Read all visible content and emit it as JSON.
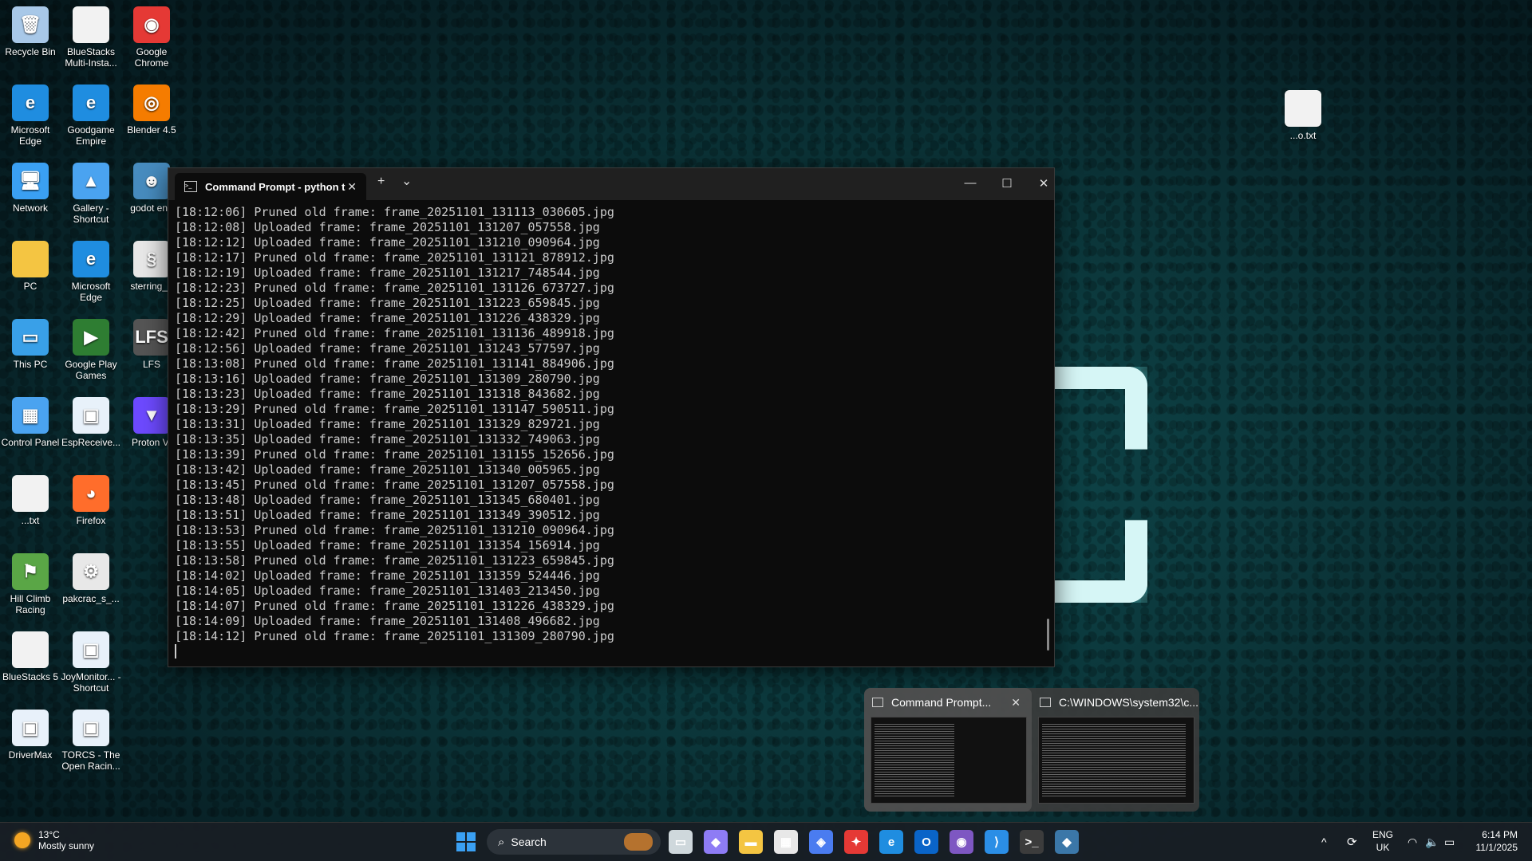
{
  "desktop": {
    "icons": [
      {
        "label": "Recycle Bin",
        "glyph": "🗑",
        "color": "#a8c8e8"
      },
      {
        "label": "BlueStacks Multi-Insta...",
        "glyph": "",
        "color": "#f2f2f2"
      },
      {
        "label": "Google Chrome",
        "glyph": "◉",
        "color": "#e53935"
      },
      {
        "label": "Microsoft Edge",
        "glyph": "e",
        "color": "#1f8de0"
      },
      {
        "label": "Goodgame Empire",
        "glyph": "e",
        "color": "#1f8de0"
      },
      {
        "label": "Blender 4.5",
        "glyph": "◎",
        "color": "#f57c00"
      },
      {
        "label": "Network",
        "glyph": "🖥",
        "color": "#3aa0f3"
      },
      {
        "label": "Gallery - Shortcut",
        "glyph": "▲",
        "color": "#4aa3f0"
      },
      {
        "label": "godot eng",
        "glyph": "☻",
        "color": "#478cbf"
      },
      {
        "label": "PC",
        "glyph": "",
        "color": "#f4c542"
      },
      {
        "label": "Microsoft Edge",
        "glyph": "e",
        "color": "#1f8de0"
      },
      {
        "label": "sterring_a",
        "glyph": "§",
        "color": "#e8e8e8"
      },
      {
        "label": "This PC",
        "glyph": "▭",
        "color": "#39a0e8"
      },
      {
        "label": "Google Play Games",
        "glyph": "▶",
        "color": "#2e7d32"
      },
      {
        "label": "LFS",
        "glyph": "LFS",
        "color": "#555"
      },
      {
        "label": "Control Panel",
        "glyph": "▦",
        "color": "#4aa3f0"
      },
      {
        "label": "EspReceive...",
        "glyph": "▣",
        "color": "#e8f1fa"
      },
      {
        "label": "Proton VI",
        "glyph": "▼",
        "color": "#6d4aff"
      },
      {
        "label": "...txt",
        "glyph": "",
        "color": "#f2f2f2"
      },
      {
        "label": "Firefox",
        "glyph": "◕",
        "color": "#ff6d2b"
      },
      {
        "label": "Hill Climb Racing",
        "glyph": "⚑",
        "color": "#5aa646"
      },
      {
        "label": "pakcrac_s_...",
        "glyph": "⚙",
        "color": "#e8e8e8"
      },
      {
        "label": "BlueStacks 5",
        "glyph": "",
        "color": "#f2f2f2"
      },
      {
        "label": "JoyMonitor... - Shortcut",
        "glyph": "▣",
        "color": "#e8f1fa"
      },
      {
        "label": "DriverMax",
        "glyph": "▣",
        "color": "#e8f1fa"
      },
      {
        "label": "TORCS - The Open Racin...",
        "glyph": "▣",
        "color": "#e8f1fa"
      },
      {
        "label": "...o.txt",
        "glyph": "",
        "color": "#f2f2f2"
      }
    ]
  },
  "terminal": {
    "tab_title": "Command Prompt - python  t",
    "new_tab": "+",
    "dropdown": "⌄",
    "minimize": "—",
    "maximize": "☐",
    "close": "✕",
    "lines": [
      "[18:12:06] Pruned old frame: frame_20251101_131113_030605.jpg",
      "[18:12:08] Uploaded frame: frame_20251101_131207_057558.jpg",
      "[18:12:12] Uploaded frame: frame_20251101_131210_090964.jpg",
      "[18:12:17] Pruned old frame: frame_20251101_131121_878912.jpg",
      "[18:12:19] Uploaded frame: frame_20251101_131217_748544.jpg",
      "[18:12:23] Pruned old frame: frame_20251101_131126_673727.jpg",
      "[18:12:25] Uploaded frame: frame_20251101_131223_659845.jpg",
      "[18:12:29] Uploaded frame: frame_20251101_131226_438329.jpg",
      "[18:12:42] Pruned old frame: frame_20251101_131136_489918.jpg",
      "[18:12:56] Uploaded frame: frame_20251101_131243_577597.jpg",
      "[18:13:08] Pruned old frame: frame_20251101_131141_884906.jpg",
      "[18:13:16] Uploaded frame: frame_20251101_131309_280790.jpg",
      "[18:13:23] Uploaded frame: frame_20251101_131318_843682.jpg",
      "[18:13:29] Pruned old frame: frame_20251101_131147_590511.jpg",
      "[18:13:31] Uploaded frame: frame_20251101_131329_829721.jpg",
      "[18:13:35] Uploaded frame: frame_20251101_131332_749063.jpg",
      "[18:13:39] Pruned old frame: frame_20251101_131155_152656.jpg",
      "[18:13:42] Uploaded frame: frame_20251101_131340_005965.jpg",
      "[18:13:45] Pruned old frame: frame_20251101_131207_057558.jpg",
      "[18:13:48] Uploaded frame: frame_20251101_131345_680401.jpg",
      "[18:13:51] Uploaded frame: frame_20251101_131349_390512.jpg",
      "[18:13:53] Pruned old frame: frame_20251101_131210_090964.jpg",
      "[18:13:55] Uploaded frame: frame_20251101_131354_156914.jpg",
      "[18:13:58] Pruned old frame: frame_20251101_131223_659845.jpg",
      "[18:14:02] Uploaded frame: frame_20251101_131359_524446.jpg",
      "[18:14:05] Uploaded frame: frame_20251101_131403_213450.jpg",
      "[18:14:07] Pruned old frame: frame_20251101_131226_438329.jpg",
      "[18:14:09] Uploaded frame: frame_20251101_131408_496682.jpg",
      "[18:14:12] Pruned old frame: frame_20251101_131309_280790.jpg"
    ]
  },
  "previews": [
    {
      "title": "Command Prompt...",
      "close": "✕"
    },
    {
      "title": "C:\\WINDOWS\\system32\\c..."
    }
  ],
  "taskbar": {
    "weather_temp": "13°C",
    "weather_desc": "Mostly sunny",
    "search_label": "Search",
    "apps": [
      {
        "name": "task-view",
        "glyph": "▭",
        "color": "#cfd8dc"
      },
      {
        "name": "copilot",
        "glyph": "◆",
        "color": "#8e7cf5"
      },
      {
        "name": "file-explorer",
        "glyph": "▬",
        "color": "#f4c542"
      },
      {
        "name": "microsoft-store",
        "glyph": "▦",
        "color": "#e8e8e8"
      },
      {
        "name": "app-blue-shield",
        "glyph": "◈",
        "color": "#4a7cf0"
      },
      {
        "name": "app-red",
        "glyph": "✦",
        "color": "#e53935"
      },
      {
        "name": "edge",
        "glyph": "e",
        "color": "#1f8de0"
      },
      {
        "name": "outlook",
        "glyph": "O",
        "color": "#0a64c8"
      },
      {
        "name": "app-purple",
        "glyph": "◉",
        "color": "#7e57c2"
      },
      {
        "name": "vscode",
        "glyph": "⟩",
        "color": "#2b8ee6"
      },
      {
        "name": "terminal",
        "glyph": ">_",
        "color": "#3c3c3c"
      },
      {
        "name": "python",
        "glyph": "◆",
        "color": "#3b77a8"
      }
    ],
    "tray_chevron": "^",
    "lang_line1": "ENG",
    "lang_line2": "UK",
    "time": "6:14 PM",
    "date": "11/1/2025"
  }
}
